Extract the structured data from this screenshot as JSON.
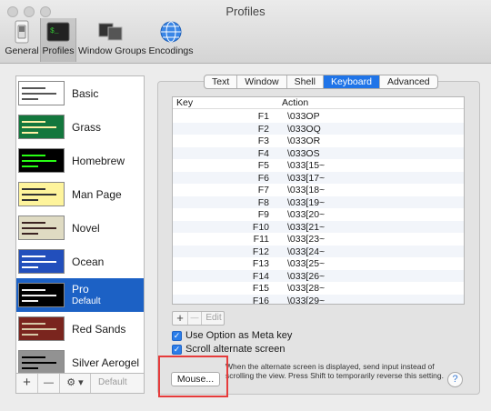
{
  "window": {
    "title": "Profiles"
  },
  "toolbar": {
    "items": [
      {
        "label": "General",
        "icon": "light-switch-icon"
      },
      {
        "label": "Profiles",
        "icon": "terminal-icon"
      },
      {
        "label": "Window Groups",
        "icon": "window-groups-icon"
      },
      {
        "label": "Encodings",
        "icon": "globe-icon"
      }
    ],
    "active": "Profiles"
  },
  "profiles": {
    "items": [
      {
        "name": "Basic",
        "bg": "#ffffff",
        "fg": "#333333"
      },
      {
        "name": "Grass",
        "bg": "#13773d",
        "fg": "#fff0a5"
      },
      {
        "name": "Homebrew",
        "bg": "#000000",
        "fg": "#28fe14"
      },
      {
        "name": "Man Page",
        "bg": "#fef49c",
        "fg": "#333333"
      },
      {
        "name": "Novel",
        "bg": "#dfdbc3",
        "fg": "#3b2322"
      },
      {
        "name": "Ocean",
        "bg": "#224fbc",
        "fg": "#ffffff"
      },
      {
        "name": "Pro",
        "sub": "Default",
        "bg": "#000000",
        "fg": "#f2f2f2",
        "selected": true
      },
      {
        "name": "Red Sands",
        "bg": "#7a251e",
        "fg": "#d7c9a7"
      },
      {
        "name": "Silver Aerogel",
        "bg": "#929292",
        "fg": "#000000"
      }
    ],
    "add_label": "+",
    "remove_label": "—",
    "gear_label": "⚙ ▾",
    "default_label": "Default"
  },
  "tabs": {
    "items": [
      "Text",
      "Window",
      "Shell",
      "Keyboard",
      "Advanced"
    ],
    "active": "Keyboard"
  },
  "keytable": {
    "col_key": "Key",
    "col_action": "Action",
    "rows": [
      {
        "key": "F1",
        "action": "\\033OP"
      },
      {
        "key": "F2",
        "action": "\\033OQ"
      },
      {
        "key": "F3",
        "action": "\\033OR"
      },
      {
        "key": "F4",
        "action": "\\033OS"
      },
      {
        "key": "F5",
        "action": "\\033[15~"
      },
      {
        "key": "F6",
        "action": "\\033[17~"
      },
      {
        "key": "F7",
        "action": "\\033[18~"
      },
      {
        "key": "F8",
        "action": "\\033[19~"
      },
      {
        "key": "F9",
        "action": "\\033[20~"
      },
      {
        "key": "F10",
        "action": "\\033[21~"
      },
      {
        "key": "F11",
        "action": "\\033[23~"
      },
      {
        "key": "F12",
        "action": "\\033[24~"
      },
      {
        "key": "F13",
        "action": "\\033[25~"
      },
      {
        "key": "F14",
        "action": "\\033[26~"
      },
      {
        "key": "F15",
        "action": "\\033[28~"
      },
      {
        "key": "F16",
        "action": "\\033[29~"
      }
    ],
    "add_label": "+",
    "remove_label": "—",
    "edit_label": "Edit"
  },
  "options": {
    "meta_key_label": "Use Option as Meta key",
    "meta_key_checked": true,
    "scroll_alt_label": "Scroll alternate screen",
    "scroll_alt_checked": true,
    "note": "When the alternate screen is displayed, send input instead of scrolling the view. Press Shift to temporarily reverse this setting.",
    "mouse_button": "Mouse...",
    "help_label": "?"
  },
  "colors": {
    "accent": "#1f74e8",
    "selection": "#1c61c5",
    "highlight_box": "#e63b3b"
  }
}
